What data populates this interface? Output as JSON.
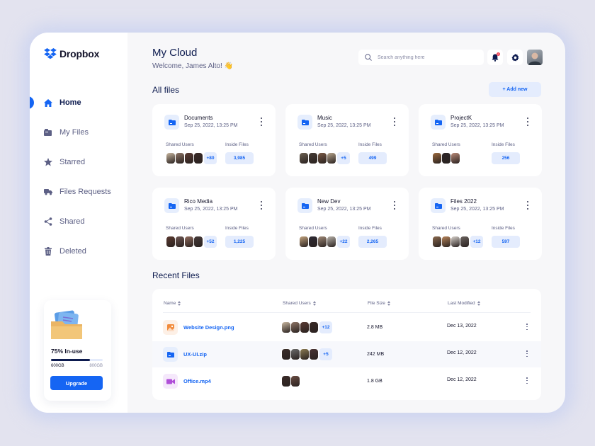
{
  "app": {
    "brand": "Dropbox",
    "brand_color": "#1565f3"
  },
  "sidebar": {
    "items": [
      {
        "label": "Home",
        "icon": "home-icon",
        "active": true
      },
      {
        "label": "My Files",
        "icon": "folder-icon",
        "active": false
      },
      {
        "label": "Starred",
        "icon": "star-icon",
        "active": false
      },
      {
        "label": "Files Requests",
        "icon": "truck-icon",
        "active": false
      },
      {
        "label": "Shared",
        "icon": "share-icon",
        "active": false
      },
      {
        "label": "Deleted",
        "icon": "trash-icon",
        "active": false
      }
    ],
    "storage": {
      "usage_label": "75% In-use",
      "used_fraction": 0.75,
      "used_label": "600GB",
      "total_label": "800GB",
      "upgrade_label": "Upgrade"
    }
  },
  "header": {
    "title": "My Cloud",
    "welcome": "Welcome, James Alto! 👋",
    "search_placeholder": "Search anything here",
    "notification_count": "0"
  },
  "all_files": {
    "title": "All files",
    "add_new_label": "+ Add new",
    "shared_users_label": "Shared Users",
    "inside_files_label": "Inside Files",
    "folders": [
      {
        "name": "Documents",
        "date": "Sep 25, 2022, 13:25 PM",
        "extra_users": "+80",
        "inside_files": "3,985",
        "avatars": [
          "#c9b7a0",
          "#8e7566",
          "#5a3b33",
          "#3a2a26"
        ]
      },
      {
        "name": "Music",
        "date": "Sep 25, 2022, 13:25 PM",
        "extra_users": "+5",
        "inside_files": "499",
        "avatars": [
          "#6d6152",
          "#463c35",
          "#7a5a45",
          "#b7a58d"
        ]
      },
      {
        "name": "ProjectK",
        "date": "Sep 25, 2022, 13:25 PM",
        "extra_users": "",
        "inside_files": "256",
        "avatars": [
          "#9c6a3e",
          "#2e2628",
          "#b98a78"
        ]
      },
      {
        "name": "Rico Media",
        "date": "Sep 25, 2022, 13:25 PM",
        "extra_users": "+52",
        "inside_files": "1,225",
        "avatars": [
          "#5b3a30",
          "#6e5652",
          "#8f6b5d",
          "#453a38"
        ]
      },
      {
        "name": "New Dev",
        "date": "Sep 25, 2022, 13:25 PM",
        "extra_users": "+22",
        "inside_files": "2,265",
        "avatars": [
          "#c2a37d",
          "#2d2a33",
          "#a08a78",
          "#b8b2aa"
        ]
      },
      {
        "name": "Files 2022",
        "date": "Sep 25, 2022, 13:25 PM",
        "extra_users": "+12",
        "inside_files": "597",
        "avatars": [
          "#8a6a4e",
          "#b7845a",
          "#d8d2cc",
          "#6c6460"
        ]
      }
    ]
  },
  "recent_files": {
    "title": "Recent Files",
    "columns": [
      "Name",
      "Shared Users",
      "File Size",
      "Last Modified"
    ],
    "rows": [
      {
        "name": "Website Design.png",
        "type": "image",
        "icon": "image-icon",
        "icon_color": "#f28b3b",
        "icon_bg": "#fdf0e6",
        "extra_users": "+12",
        "size": "2.8 MB",
        "modified": "Dec 13, 2022",
        "avatars": [
          "#c9b7a0",
          "#8e7566",
          "#5a3b33",
          "#3a2a26"
        ]
      },
      {
        "name": "UX-UI.zip",
        "type": "folder",
        "icon": "folder-icon",
        "icon_color": "#1565f3",
        "icon_bg": "#e6eefd",
        "extra_users": "+5",
        "size": "242 MB",
        "modified": "Dec 12, 2022",
        "avatars": [
          "#3b2e2a",
          "#6b6b6b",
          "#8a7a52",
          "#4a3434"
        ]
      },
      {
        "name": "Office.mp4",
        "type": "video",
        "icon": "video-icon",
        "icon_color": "#b04fd8",
        "icon_bg": "#f5e8fb",
        "extra_users": "",
        "size": "1.8 GB",
        "modified": "Dec 12, 2022",
        "avatars": [
          "#3a2b28",
          "#6a4c42"
        ]
      }
    ]
  }
}
